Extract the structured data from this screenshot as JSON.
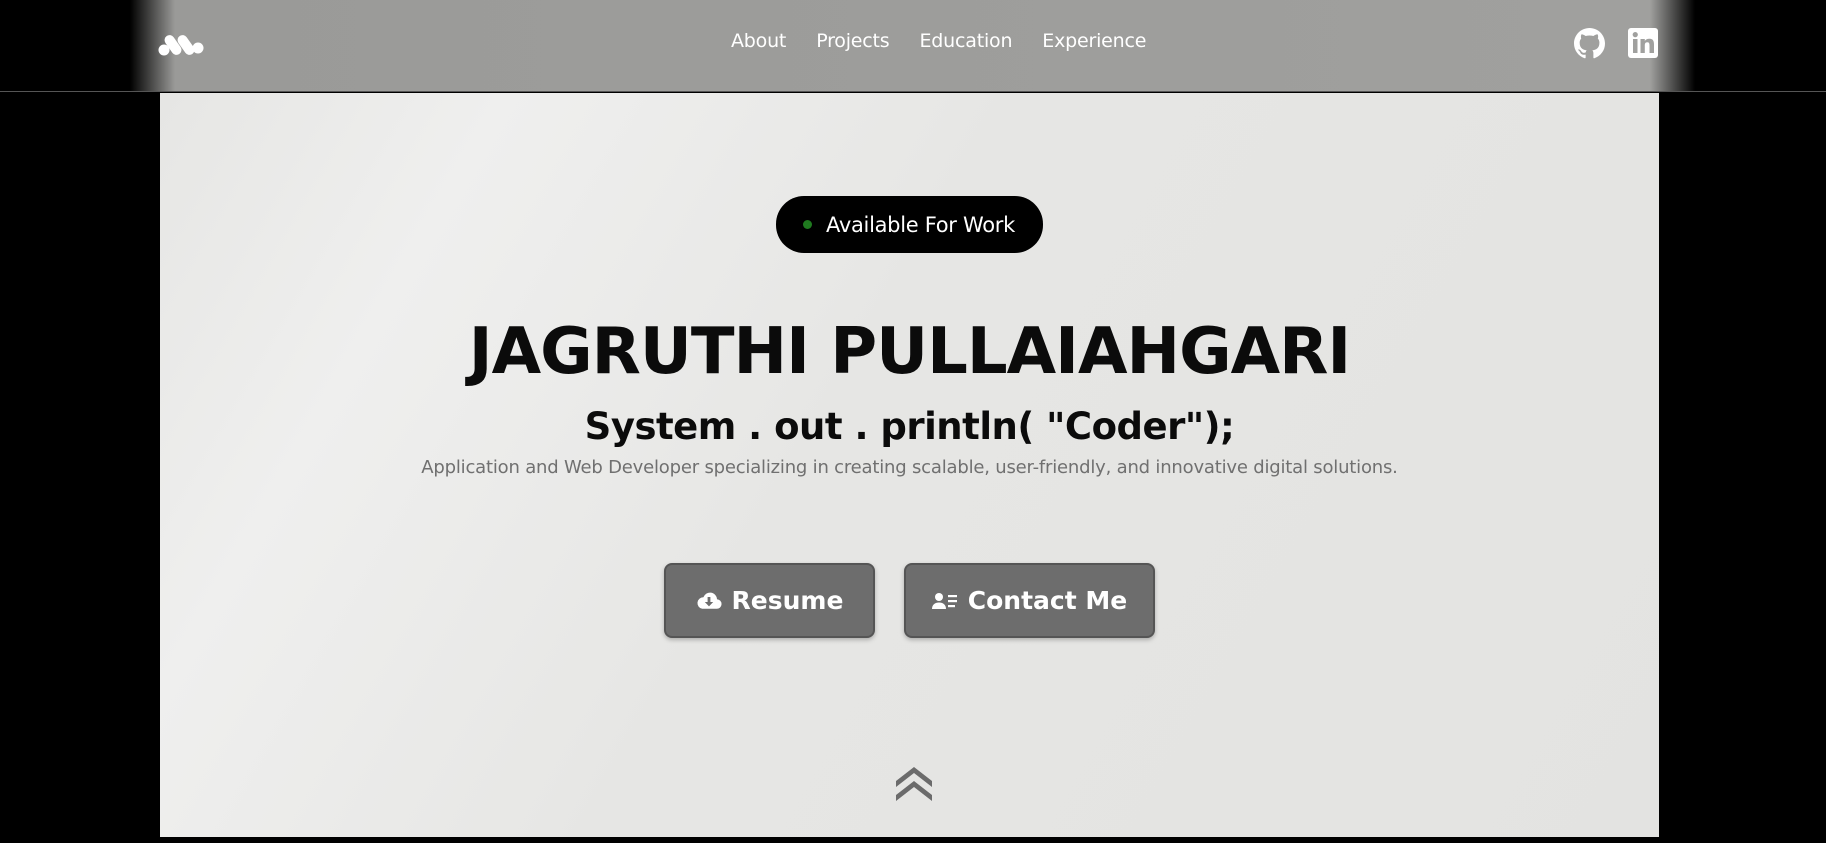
{
  "header": {
    "logo_icon": "brand-logo-icon",
    "nav": [
      {
        "label": "About"
      },
      {
        "label": "Projects"
      },
      {
        "label": "Education"
      },
      {
        "label": "Experience"
      }
    ],
    "social": {
      "github_icon": "github-icon",
      "linkedin_icon": "linkedin-icon"
    }
  },
  "hero": {
    "badge": {
      "label": "Available For Work",
      "dot_color": "#1f7a1f"
    },
    "name": "JAGRUTHI PULLAIAHGARI",
    "tagline": "System . out . println( \"Coder\");",
    "description": "Application and Web Developer specializing in creating scalable, user-friendly, and innovative digital solutions.",
    "buttons": {
      "resume": {
        "label": "Resume",
        "icon": "cloud-download-icon"
      },
      "contact": {
        "label": "Contact Me",
        "icon": "contact-card-icon"
      }
    },
    "scroll_icon": "double-chevron-up-icon"
  },
  "colors": {
    "accent_button": "#6d6d6d",
    "badge_bg": "#000000",
    "text_primary": "#0b0b0b",
    "text_muted": "#707070"
  }
}
